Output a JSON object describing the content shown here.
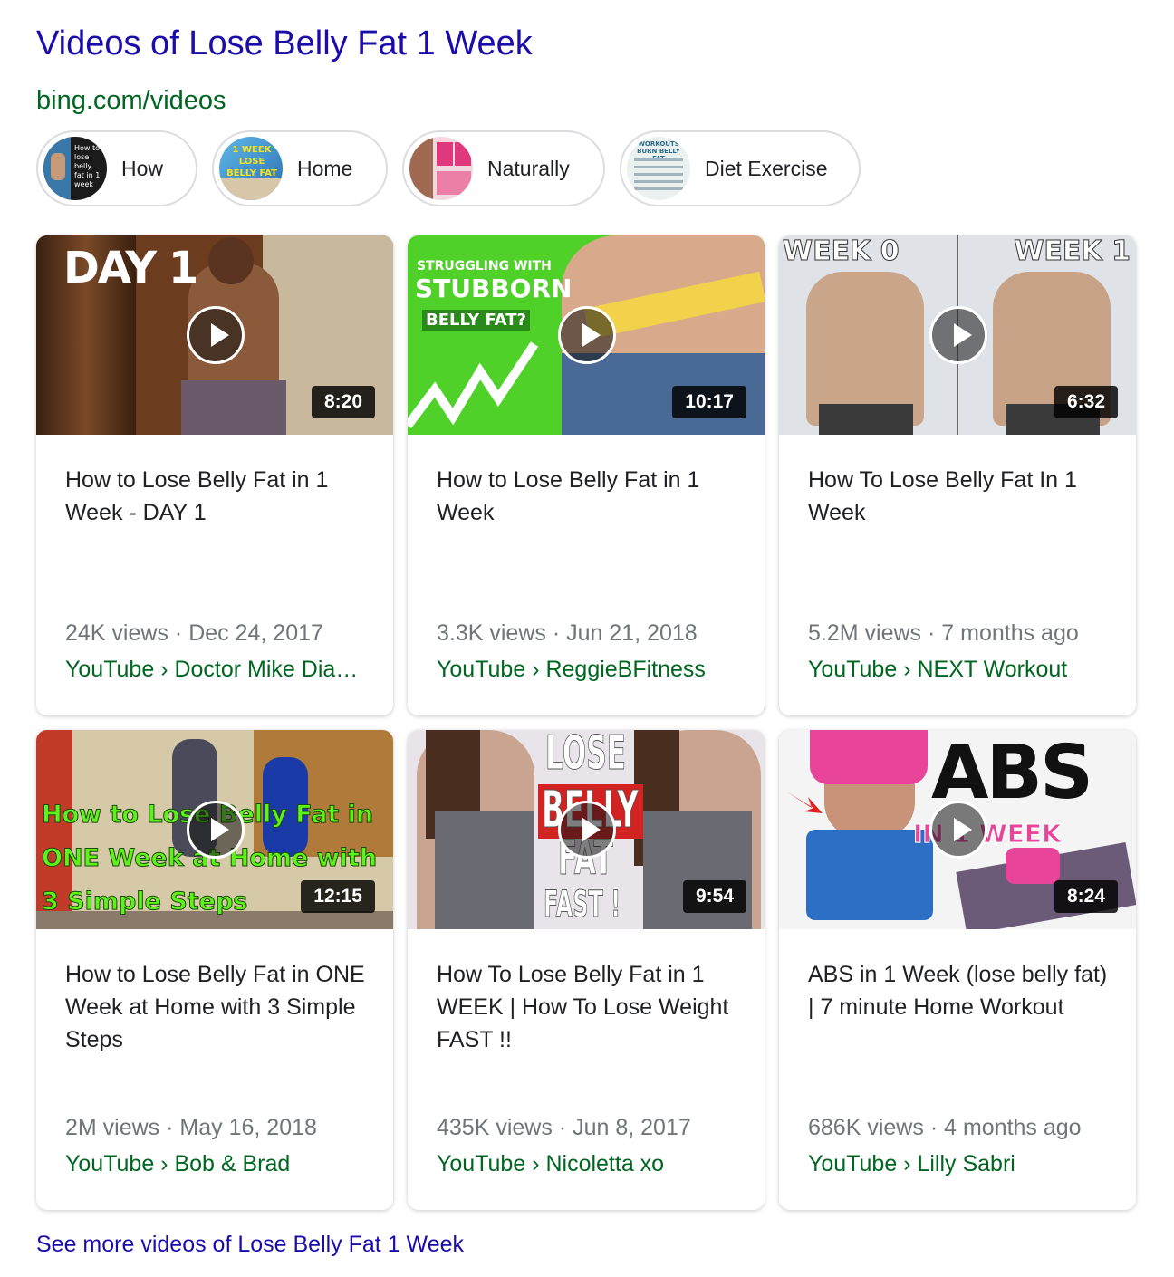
{
  "header": {
    "title": "Videos of Lose Belly Fat 1 Week",
    "source": "bing.com/videos"
  },
  "chips": [
    {
      "label": "How",
      "thumb_text": "How to lose belly fat in 1 week"
    },
    {
      "label": "Home",
      "thumb_text": "1 WEEK LOSE BELLY FAT"
    },
    {
      "label": "Naturally"
    },
    {
      "label": "Diet Exercise",
      "thumb_text": "WORKOUTS BURN BELLY FAT"
    }
  ],
  "videos": [
    {
      "title": "How to Lose Belly Fat in 1 Week - DAY 1",
      "duration": "8:20",
      "views": "24K views",
      "date": "Dec 24, 2017",
      "channel": "YouTube › Doctor Mike Dia…",
      "overlay": [
        "DAY 1"
      ]
    },
    {
      "title": "How to Lose Belly Fat in 1 Week",
      "duration": "10:17",
      "views": "3.3K views",
      "date": "Jun 21, 2018",
      "channel": "YouTube › ReggieBFitness",
      "overlay": [
        "STRUGGLING WITH",
        "STUBBORN",
        "BELLY FAT?"
      ]
    },
    {
      "title": "How To Lose Belly Fat In 1 Week",
      "duration": "6:32",
      "views": "5.2M views",
      "date": "7 months ago",
      "channel": "YouTube › NEXT Workout",
      "overlay": [
        "WEEK 0",
        "WEEK 1"
      ]
    },
    {
      "title": "How to Lose Belly Fat in ONE Week at Home with 3 Simple Steps",
      "duration": "12:15",
      "views": "2M views",
      "date": "May 16, 2018",
      "channel": "YouTube › Bob & Brad",
      "overlay": [
        "How to Lose Belly Fat in",
        "ONE Week at Home with",
        "3 Simple Steps"
      ]
    },
    {
      "title": "How To Lose Belly Fat in 1 WEEK | How To Lose Weight FAST !!",
      "duration": "9:54",
      "views": "435K views",
      "date": "Jun 8, 2017",
      "channel": "YouTube › Nicoletta xo",
      "overlay": [
        "LOSE",
        "BELLY",
        "FAT",
        "FAST !"
      ]
    },
    {
      "title": "ABS in 1 Week (lose belly fat) | 7 minute Home Workout",
      "duration": "8:24",
      "views": "686K views",
      "date": "4 months ago",
      "channel": "YouTube › Lilly Sabri",
      "overlay": [
        "ABS",
        "IN 1 WEEK"
      ]
    }
  ],
  "meta_separator": "·",
  "see_more": "See more videos of Lose Belly Fat 1 Week"
}
